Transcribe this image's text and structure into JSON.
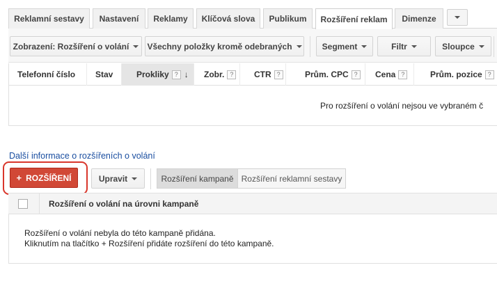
{
  "tabs": [
    {
      "label": "Reklamní sestavy"
    },
    {
      "label": "Nastavení"
    },
    {
      "label": "Reklamy"
    },
    {
      "label": "Klíčová slova"
    },
    {
      "label": "Publikum"
    },
    {
      "label": "Rozšíření reklam",
      "active": true
    },
    {
      "label": "Dimenze"
    }
  ],
  "toolbar": {
    "view": "Zobrazení: Rozšíření o volání",
    "filter_items": "Všechny položky kromě odebraných",
    "segment": "Segment",
    "filter": "Filtr",
    "columns": "Sloupce"
  },
  "table": {
    "columns": [
      "Telefonní číslo",
      "Stav",
      "Prokliky",
      "Zobr.",
      "CTR",
      "Prům. CPC",
      "Cena",
      "Prům. pozice"
    ],
    "help": "?",
    "empty_message": "Pro rozšíření o volání nejsou ve vybraném č"
  },
  "info_link": "Další informace o rozšířeních o volání",
  "actions": {
    "add_button": "ROZŠÍŘENÍ",
    "add_plus": "+",
    "edit_button": "Upravit",
    "segment_campaign": "Rozšíření kampaně",
    "segment_adgroup": "Rozšíření reklamní sestavy"
  },
  "campaign_table": {
    "header": "Rozšíření o volání na úrovni kampaně",
    "message_line1": "Rozšíření o volání nebyla do této kampaně přidána.",
    "message_line2": "Kliknutím na tlačítko + Rozšíření přidáte rozšíření do této kampaně."
  },
  "colors": {
    "accent_red": "#d14836",
    "link_blue": "#1a4ea0",
    "highlight_outline": "#d9362b"
  }
}
